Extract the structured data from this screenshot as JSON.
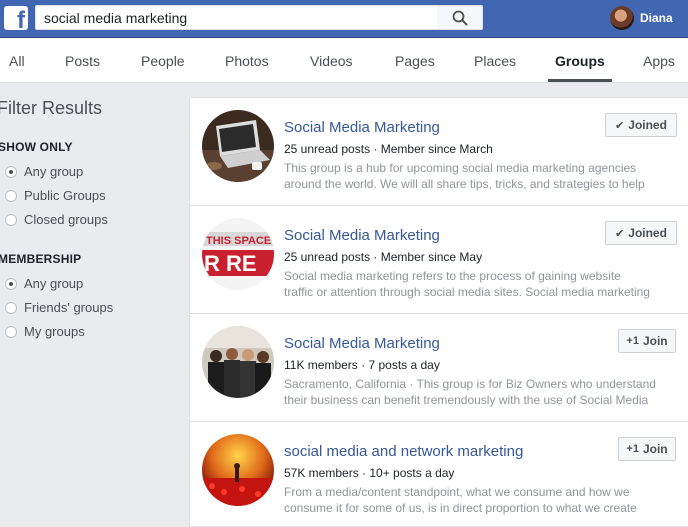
{
  "header": {
    "logo": "f",
    "search_value": "social media marketing",
    "user_name": "Diana"
  },
  "tabs": [
    "All",
    "Posts",
    "People",
    "Photos",
    "Videos",
    "Pages",
    "Places",
    "Groups",
    "Apps"
  ],
  "active_tab": "Groups",
  "sidebar": {
    "title": "Filter Results",
    "show_only": {
      "heading": "SHOW ONLY",
      "options": [
        "Any group",
        "Public Groups",
        "Closed groups"
      ],
      "selected": "Any group"
    },
    "membership": {
      "heading": "MEMBERSHIP",
      "options": [
        "Any group",
        "Friends' groups",
        "My groups"
      ],
      "selected": "Any group"
    }
  },
  "results": [
    {
      "name": "Social Media Marketing",
      "meta": "25 unread posts · Member since March",
      "desc_line1": "This group is a hub for upcoming social media marketing agencies",
      "desc_line2": "around the world. We will all share tips, tricks, and strategies to help",
      "button": "Joined",
      "button_icon": "checkmark-icon"
    },
    {
      "name": "Social Media Marketing",
      "meta": "25 unread posts · Member since May",
      "desc_line1": "Social media marketing refers to the process of gaining website",
      "desc_line2": "traffic or attention through social media sites. Social media marketing",
      "button": "Joined",
      "button_icon": "checkmark-icon"
    },
    {
      "name": "Social Media Marketing",
      "meta": "11K members · 7 posts a day",
      "desc_line1": "Sacramento, California · This group is for Biz Owners who understand",
      "desc_line2": "their business can benefit tremendously with the use of Social Media",
      "button": "Join",
      "button_icon": "add-person-icon"
    },
    {
      "name": "social media and network marketing",
      "meta": "57K members · 10+ posts a day",
      "desc_line1": "From a media/content standpoint, what we consume and how we",
      "desc_line2": "consume it for some of us, is in direct proportion to what we create",
      "button": "Join",
      "button_icon": "add-person-icon"
    }
  ],
  "thumb_text": {
    "line1": "THIS SPACE",
    "line2": "R RE"
  },
  "colors": {
    "brand": "#4267b2",
    "link": "#365899",
    "muted": "#90949c"
  }
}
